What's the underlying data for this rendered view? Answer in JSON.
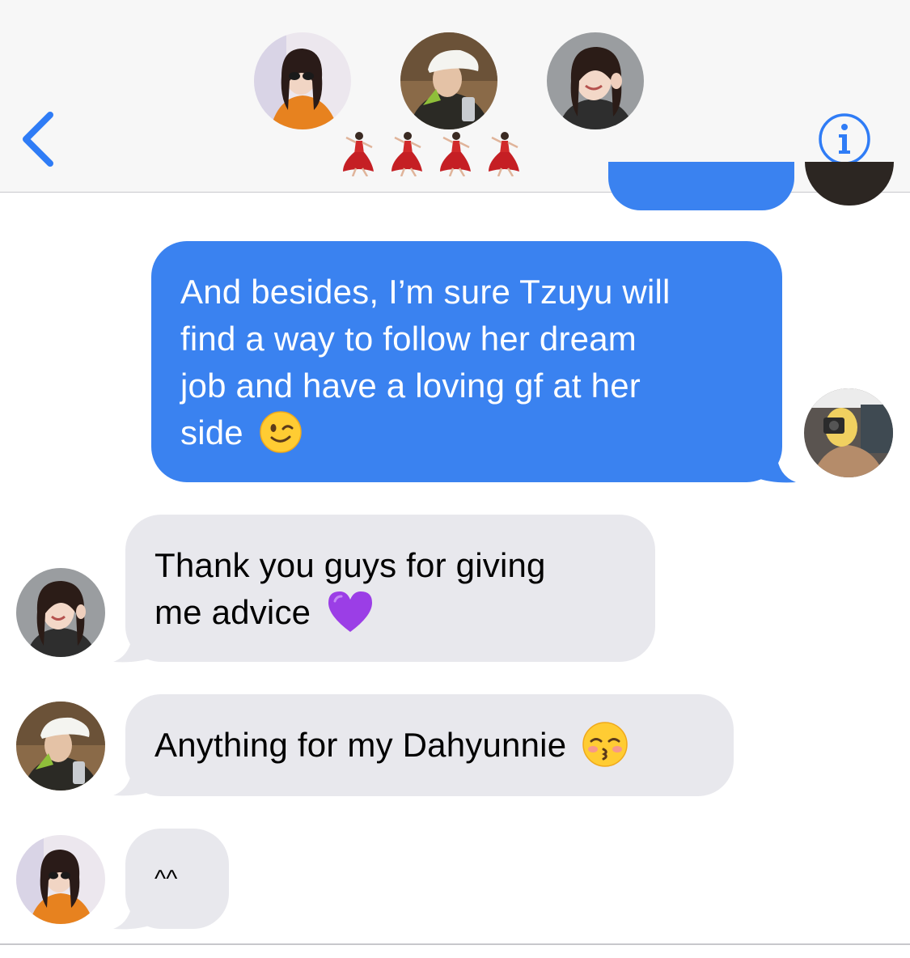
{
  "header": {
    "group_name_icons": [
      "dancer-emoji",
      "dancer-emoji",
      "dancer-emoji",
      "dancer-emoji"
    ],
    "back_icon": "chevron-left-icon",
    "info_icon": "info-icon",
    "accent_color": "#2f7cf6"
  },
  "messages": [
    {
      "direction": "outgoing",
      "lines": [
        "And besides, I’m sure Tzuyu will",
        "find a way to follow her dream",
        "job and have a loving gf at her",
        "side"
      ],
      "emoji": "winking-face-emoji"
    },
    {
      "direction": "incoming",
      "lines": [
        "Thank you guys for giving",
        "me advice"
      ],
      "emoji": "purple-heart-emoji"
    },
    {
      "direction": "incoming",
      "lines": [
        "Anything for my Dahyunnie"
      ],
      "emoji": "kissing-face-emoji"
    },
    {
      "direction": "incoming",
      "lines": [
        "^^"
      ],
      "emoji": ""
    }
  ],
  "colors": {
    "outgoing_bubble": "#3a82f0",
    "incoming_bubble": "#e8e8ed",
    "header_bg": "#f7f7f7"
  }
}
